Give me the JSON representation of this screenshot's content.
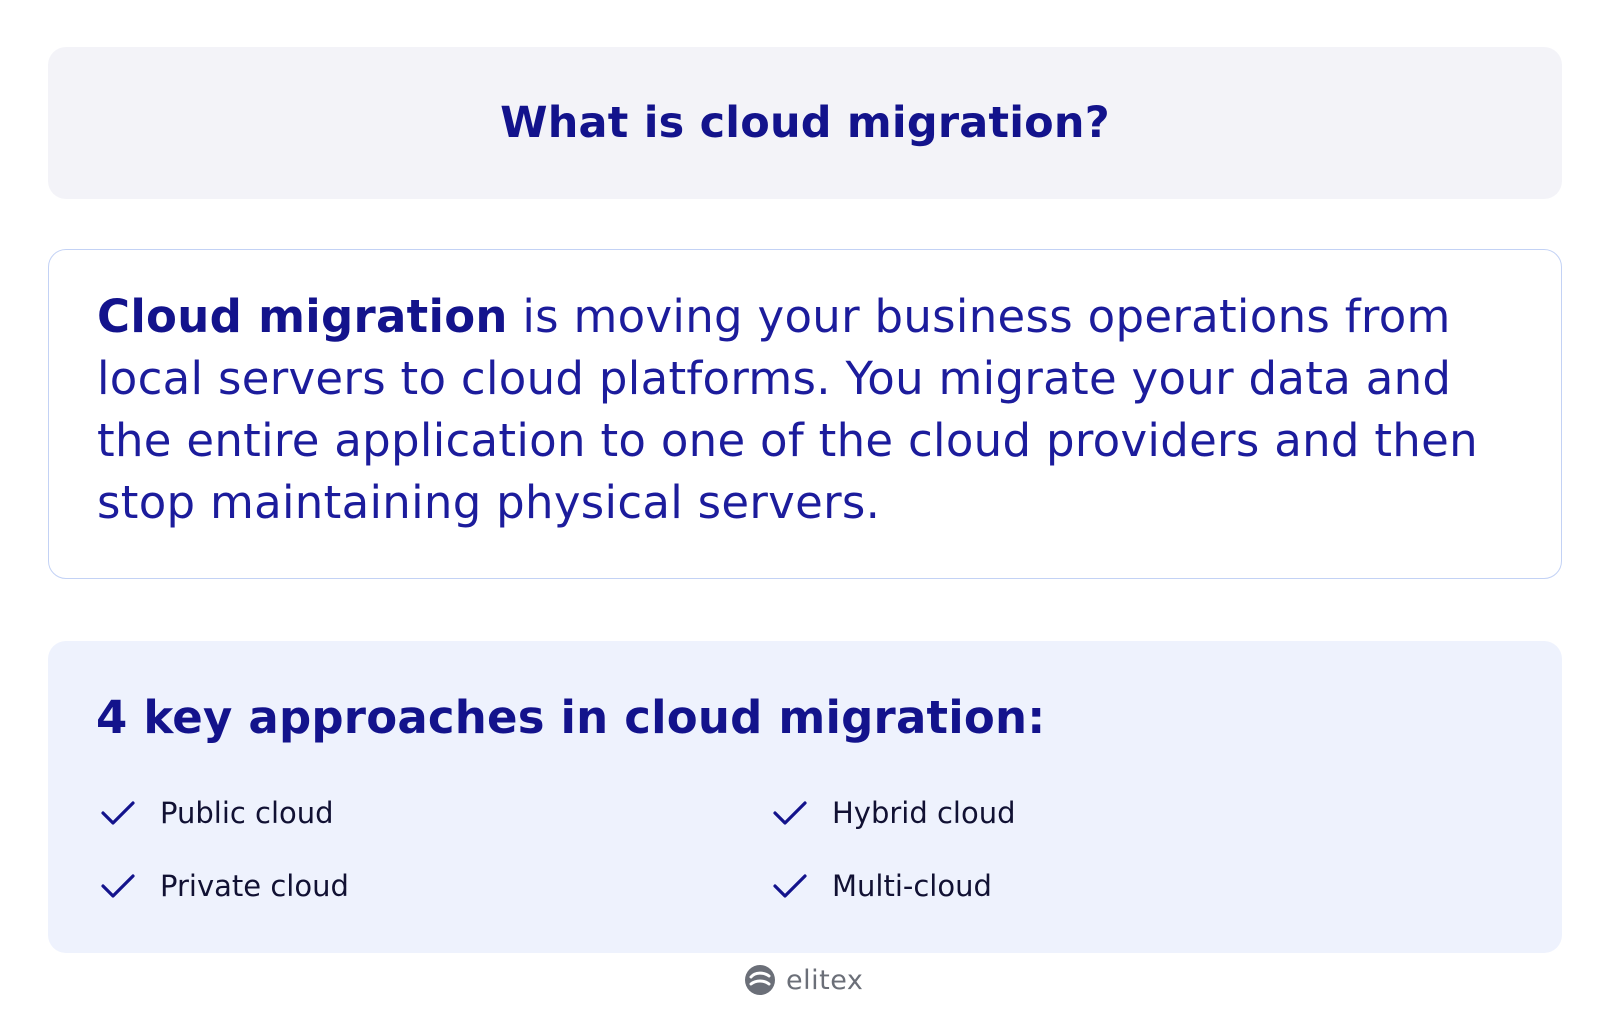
{
  "title": "What is cloud migration?",
  "definition": {
    "term": "Cloud migration",
    "text": " is moving your business operations from local servers to cloud platforms. You migrate your data and the entire application to one of the cloud providers and then stop maintaining physical servers."
  },
  "approaches": {
    "heading": "4 key approaches in cloud migration:",
    "items": [
      {
        "label": "Public cloud",
        "icon": "check-icon"
      },
      {
        "label": "Private cloud",
        "icon": "check-icon"
      },
      {
        "label": "Hybrid cloud",
        "icon": "check-icon"
      },
      {
        "label": "Multi-cloud",
        "icon": "check-icon"
      }
    ]
  },
  "brand": {
    "name": "elitex",
    "icon": "elitex-logo-icon"
  },
  "colors": {
    "accent": "#13138c",
    "text": "#1c1c9c",
    "title_bg": "#f3f3f8",
    "approaches_bg": "#eef2fd",
    "border": "#c3d2f5",
    "logo_gray": "#6b6f78"
  }
}
